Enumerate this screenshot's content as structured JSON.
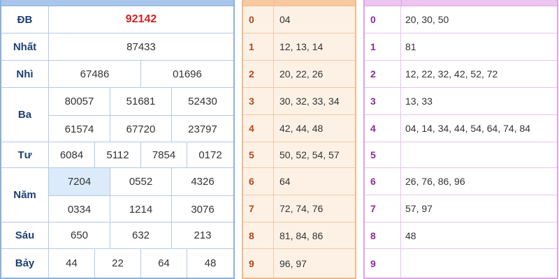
{
  "results": {
    "special": {
      "label": "ĐB",
      "numbers": [
        "92142"
      ]
    },
    "first": {
      "label": "Nhất",
      "numbers": [
        "87433"
      ]
    },
    "second": {
      "label": "Nhì",
      "numbers": [
        "67486",
        "01696"
      ]
    },
    "third": {
      "label": "Ba",
      "numbers": [
        "80057",
        "51681",
        "52430",
        "61574",
        "67720",
        "23797"
      ]
    },
    "fourth": {
      "label": "Tư",
      "numbers": [
        "6084",
        "5112",
        "7854",
        "0172"
      ]
    },
    "fifth": {
      "label": "Năm",
      "numbers": [
        "7204",
        "0552",
        "4326",
        "0334",
        "1214",
        "3076"
      ]
    },
    "sixth": {
      "label": "Sáu",
      "numbers": [
        "650",
        "632",
        "213"
      ]
    },
    "seventh": {
      "label": "Bảy",
      "numbers": [
        "44",
        "22",
        "64",
        "48"
      ]
    }
  },
  "head_table": {
    "rows": [
      {
        "digit": "0",
        "values": "04"
      },
      {
        "digit": "1",
        "values": "12, 13, 14"
      },
      {
        "digit": "2",
        "values": "20, 22, 26"
      },
      {
        "digit": "3",
        "values": "30, 32, 33, 34"
      },
      {
        "digit": "4",
        "values": "42, 44, 48"
      },
      {
        "digit": "5",
        "values": "50, 52, 54, 57"
      },
      {
        "digit": "6",
        "values": "64"
      },
      {
        "digit": "7",
        "values": "72, 74, 76"
      },
      {
        "digit": "8",
        "values": "81, 84, 86"
      },
      {
        "digit": "9",
        "values": "96, 97"
      }
    ]
  },
  "tail_table": {
    "rows": [
      {
        "digit": "0",
        "values": "20, 30, 50"
      },
      {
        "digit": "1",
        "values": "81"
      },
      {
        "digit": "2",
        "values": "12, 22, 32, 42, 52, 72"
      },
      {
        "digit": "3",
        "values": "13, 33"
      },
      {
        "digit": "4",
        "values": "04, 14, 34, 44, 54, 64, 74, 84"
      },
      {
        "digit": "5",
        "values": ""
      },
      {
        "digit": "6",
        "values": "26, 76, 86, 96"
      },
      {
        "digit": "7",
        "values": "57, 97"
      },
      {
        "digit": "8",
        "values": "48"
      },
      {
        "digit": "9",
        "values": ""
      }
    ]
  },
  "colors": {
    "results_border": "#8ab1e0",
    "prize_label": "#1e3f73",
    "special_number": "#d32020",
    "highlight_cell": "#dcebfa",
    "head_border": "#f2b98a",
    "head_background": "#fdf1e6",
    "head_digit": "#b4471c",
    "tail_border": "#dda3e6",
    "tail_digit": "#8a2a9c"
  }
}
